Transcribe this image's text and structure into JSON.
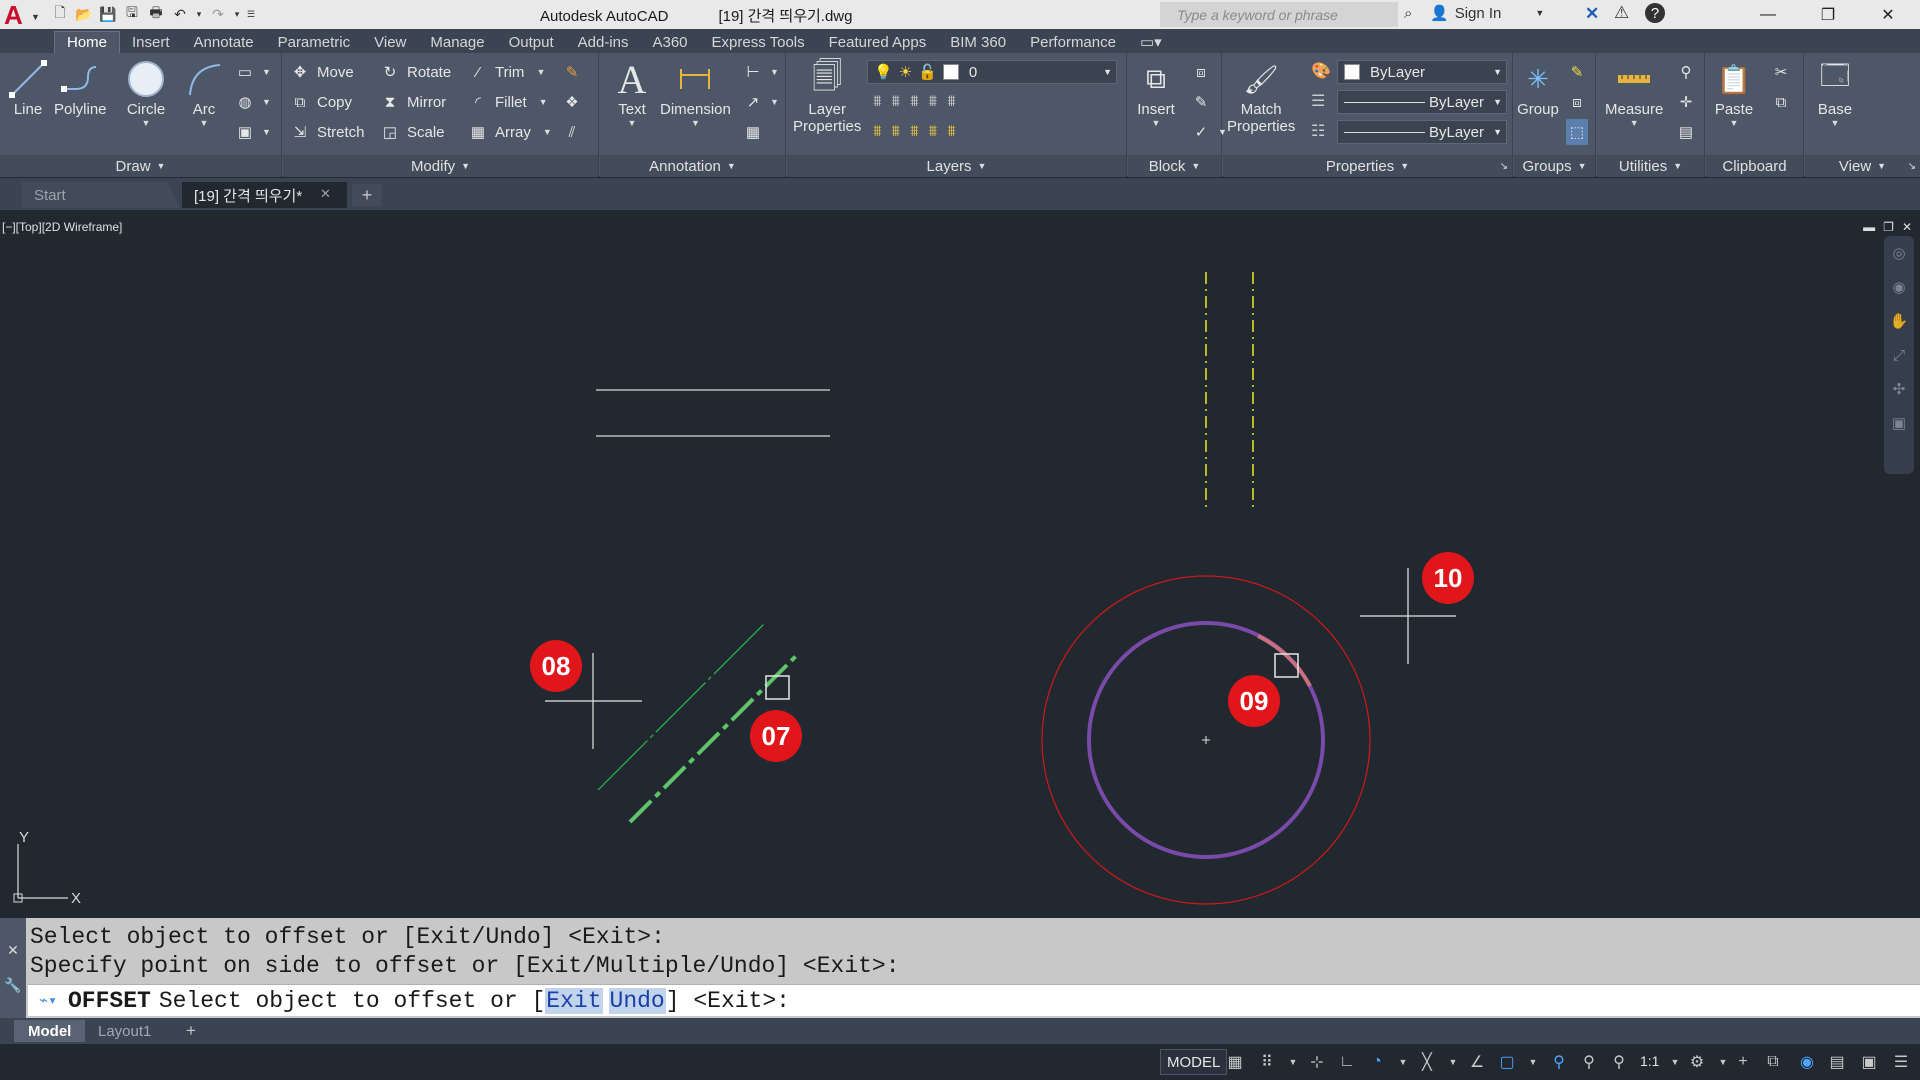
{
  "titlebar": {
    "app_name": "Autodesk AutoCAD",
    "doc_name": "[19] 간격 띄우기.dwg",
    "search_placeholder": "Type a keyword or phrase",
    "sign_in": "Sign In",
    "help": "?"
  },
  "tabs": [
    "Home",
    "Insert",
    "Annotate",
    "Parametric",
    "View",
    "Manage",
    "Output",
    "Add-ins",
    "A360",
    "Express Tools",
    "Featured Apps",
    "BIM 360",
    "Performance"
  ],
  "ribbon": {
    "draw": {
      "title": "Draw",
      "line": "Line",
      "polyline": "Polyline",
      "circle": "Circle",
      "arc": "Arc"
    },
    "modify": {
      "title": "Modify",
      "move": "Move",
      "rotate": "Rotate",
      "trim": "Trim",
      "copy": "Copy",
      "mirror": "Mirror",
      "fillet": "Fillet",
      "stretch": "Stretch",
      "scale": "Scale",
      "array": "Array"
    },
    "annotation": {
      "title": "Annotation",
      "text": "Text",
      "dimension": "Dimension"
    },
    "layers": {
      "title": "Layers",
      "layer_properties_1": "Layer",
      "layer_properties_2": "Properties",
      "current_layer": "0"
    },
    "block": {
      "title": "Block",
      "insert": "Insert"
    },
    "properties": {
      "title": "Properties",
      "match_1": "Match",
      "match_2": "Properties",
      "color": "ByLayer",
      "linetype": "ByLayer",
      "lineweight": "ByLayer"
    },
    "groups": {
      "title": "Groups",
      "group": "Group"
    },
    "utilities": {
      "title": "Utilities",
      "measure": "Measure"
    },
    "clipboard": {
      "title": "Clipboard",
      "paste": "Paste"
    },
    "view": {
      "title": "View",
      "base": "Base"
    }
  },
  "filetabs": {
    "start": "Start",
    "doc": "[19] 간격 띄우기*"
  },
  "viewport": {
    "label": "[−][Top][2D Wireframe]",
    "ucs_y": "Y",
    "ucs_x": "X",
    "badges": [
      "07",
      "08",
      "09",
      "10"
    ]
  },
  "colors": {
    "background": "#212830",
    "white_line": "#d8d8d8",
    "yellow_dashed": "#e0e020",
    "green_line": "#2fb84a",
    "green_selected": "#5ec46a",
    "red_circle": "#d01818",
    "purple_circle": "#7a4aa8",
    "badge_red": "#e0161b"
  },
  "command": {
    "history_1": "Select object to offset or [Exit/Undo] <Exit>:",
    "history_2": "Specify point on side to offset or [Exit/Multiple/Undo] <Exit>:",
    "cmd_name": "OFFSET",
    "prompt_pre": "Select object to offset or [",
    "opt_exit": "Exit",
    "opt_undo": "Undo",
    "prompt_post": "] <Exit>:"
  },
  "layouttabs": {
    "model": "Model",
    "layout1": "Layout1",
    "add": "+"
  },
  "statusbar": {
    "model": "MODEL",
    "scale": "1:1"
  }
}
